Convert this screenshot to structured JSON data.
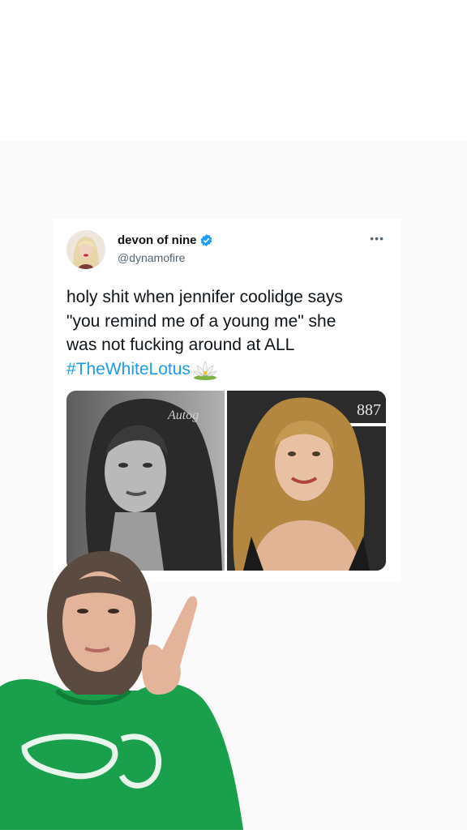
{
  "tweet": {
    "display_name": "devon of nine",
    "handle": "@dynamofire",
    "verified_icon": "verified-badge-icon",
    "more_icon": "more-options-icon",
    "text_lines": [
      "holy shit when jennifer coolidge says",
      "\"you remind me of a young me\" she",
      "was not fucking around at ALL"
    ],
    "hashtag": "#TheWhiteLotus",
    "emoji": "lotus-emoji-icon",
    "images": {
      "left": {
        "description": "black-and-white portrait",
        "watermark": "Autog"
      },
      "right": {
        "description": "color portrait at event",
        "backdrop_text": "887"
      }
    }
  },
  "colors": {
    "accent": "#1d9bf0",
    "text_primary": "#0f1419",
    "text_secondary": "#536471",
    "hoodie": "#16a04a"
  }
}
